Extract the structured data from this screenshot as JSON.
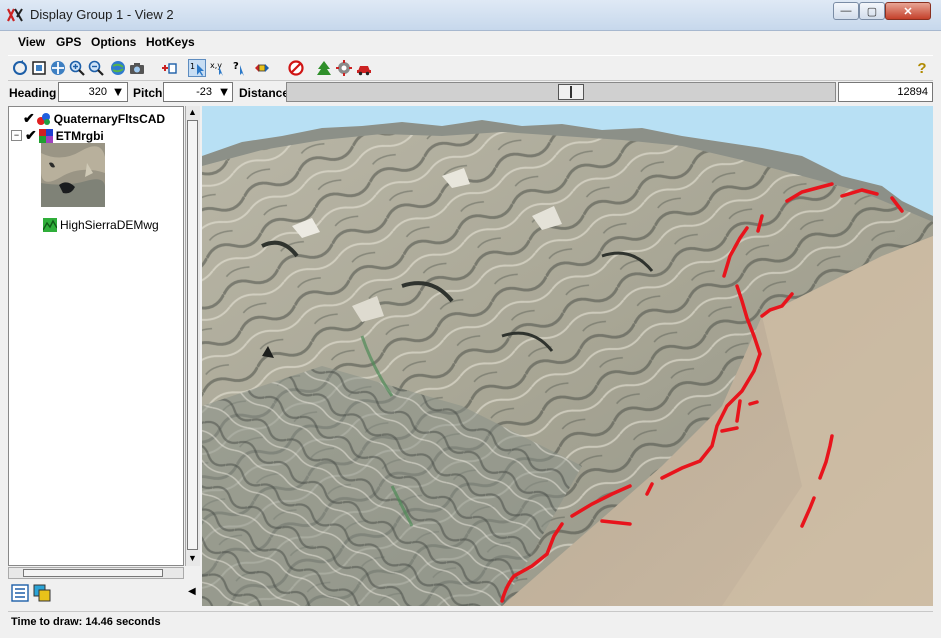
{
  "window": {
    "title": "Display Group 1 - View 2"
  },
  "window_controls": {
    "minimize": "—",
    "maximize": "▢",
    "close": "✕"
  },
  "menu": [
    "View",
    "GPS",
    "Options",
    "HotKeys"
  ],
  "toolbar": {
    "icons": [
      "redraw-icon",
      "full-view-icon",
      "pan-icon",
      "zoom-in-icon",
      "zoom-out-icon",
      "globe-icon",
      "camera-icon",
      "add-layer-icon",
      "select-icon",
      "measure-icon",
      "query-icon",
      "transfer-icon",
      "stop-icon",
      "tree-icon",
      "settings-icon",
      "car-icon"
    ],
    "help": "?"
  },
  "view_controls": {
    "heading_label": "Heading",
    "heading_value": "320",
    "pitch_label": "Pitch",
    "pitch_value": "-23",
    "distance_label": "Distance",
    "distance_value": "12894",
    "distance_slider_fraction": 0.52
  },
  "layers": [
    {
      "name": "QuaternaryFltsCAD",
      "checked": true
    },
    {
      "name": "ETMrgbi",
      "checked": true,
      "expanded": true
    },
    {
      "name": "HighSierraDEMwg",
      "checked": false
    }
  ],
  "status": {
    "text": "Time to draw: 14.46 seconds"
  },
  "colors": {
    "fault_line": "#e8141c",
    "sky": "#b8e0f4",
    "terrain_light": "#cfc7b5",
    "terrain_dark": "#7f8a84"
  }
}
